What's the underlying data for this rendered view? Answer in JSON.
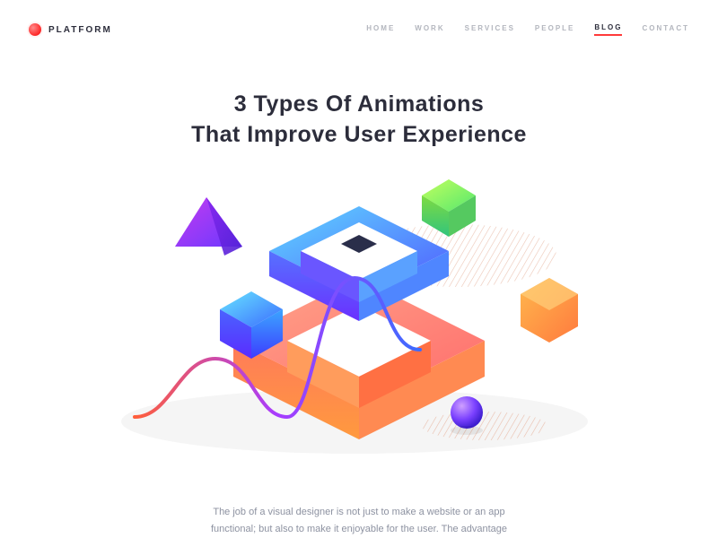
{
  "brand": {
    "name": "PLATFORM"
  },
  "nav": {
    "items": [
      {
        "label": "HOME",
        "active": false
      },
      {
        "label": "WORK",
        "active": false
      },
      {
        "label": "SERVICES",
        "active": false
      },
      {
        "label": "PEOPLE",
        "active": false
      },
      {
        "label": "BLOG",
        "active": true
      },
      {
        "label": "CONTACT",
        "active": false
      }
    ]
  },
  "article": {
    "title_line1": "3 Types Of Animations",
    "title_line2": "That Improve User Experience",
    "intro_line1": "The job of a visual designer is not just to make a website or an app",
    "intro_line2": "functional; but also to make it enjoyable for the user. The advantage"
  },
  "colors": {
    "accent": "#ff3b3b",
    "text_dark": "#2c2d3b",
    "text_muted": "#b3b6be",
    "body_muted": "#8d92a1"
  }
}
